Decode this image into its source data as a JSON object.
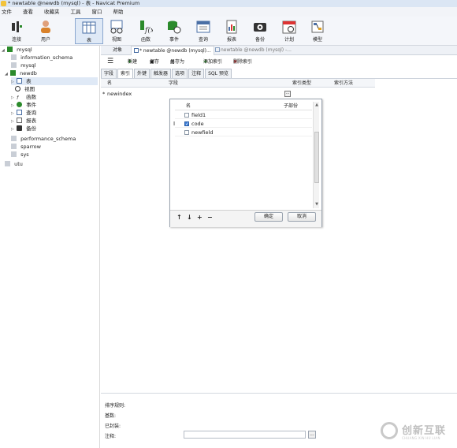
{
  "window": {
    "title": "* newtable @newdb (mysql) - 表 - Navicat Premium"
  },
  "menu": [
    "文件",
    "查看",
    "收藏夹",
    "工具",
    "窗口",
    "帮助"
  ],
  "toolbar": [
    {
      "label": "连接",
      "icon": "plug-icon"
    },
    {
      "label": "用户",
      "icon": "user-icon"
    },
    {
      "label": "表",
      "icon": "table-icon"
    },
    {
      "label": "视图",
      "icon": "view-icon"
    },
    {
      "label": "函数",
      "icon": "function-icon"
    },
    {
      "label": "事件",
      "icon": "event-icon"
    },
    {
      "label": "查询",
      "icon": "query-icon"
    },
    {
      "label": "报表",
      "icon": "report-icon"
    },
    {
      "label": "备份",
      "icon": "backup-icon"
    },
    {
      "label": "计划",
      "icon": "schedule-icon"
    },
    {
      "label": "模型",
      "icon": "model-icon"
    }
  ],
  "sidebar": {
    "connection": "mysql",
    "databases": [
      "information_schema",
      "mysql",
      "newdb"
    ],
    "newdb_children": [
      "表",
      "视图",
      "函数",
      "事件",
      "查询",
      "报表",
      "备份"
    ],
    "other_databases": [
      "performance_schema",
      "sparrow",
      "sys"
    ],
    "other_connection": "utu"
  },
  "object_tabs": {
    "objects": "对象",
    "tab1": "* newtable @newdb (mysql)...",
    "tab2": "newtable @newdb (mysql) -..."
  },
  "editor_toolbar": {
    "new": "新建",
    "save": "保存",
    "save_as": "另存为",
    "add_index": "添加索引",
    "delete_index": "删除索引"
  },
  "sub_tabs": [
    "字段",
    "索引",
    "外键",
    "触发器",
    "选项",
    "注释",
    "SQL 预览"
  ],
  "index_grid": {
    "headers": {
      "name": "名",
      "fields": "字段",
      "index_type": "索引类型",
      "index_method": "索引方法"
    },
    "rows": [
      {
        "marker": "*",
        "name": "newindex",
        "button": "..."
      }
    ]
  },
  "field_picker": {
    "headers": {
      "name": "名",
      "sub_part": "子部份"
    },
    "rows": [
      {
        "name": "field1",
        "checked": false
      },
      {
        "name": "code",
        "checked": true
      },
      {
        "name": "newfield",
        "checked": false
      }
    ],
    "controls": [
      "↑",
      "↓",
      "+",
      "−"
    ],
    "ok": "确定",
    "cancel": "取消"
  },
  "bottom_panel": {
    "sort_rule": "排序规则:",
    "cardinality": "基数:",
    "packed": "已封装:",
    "comment": "注释:",
    "comment_button": "..."
  },
  "watermark": {
    "cn": "创新互联",
    "en": "CHUANG XIN HU LIAN"
  }
}
